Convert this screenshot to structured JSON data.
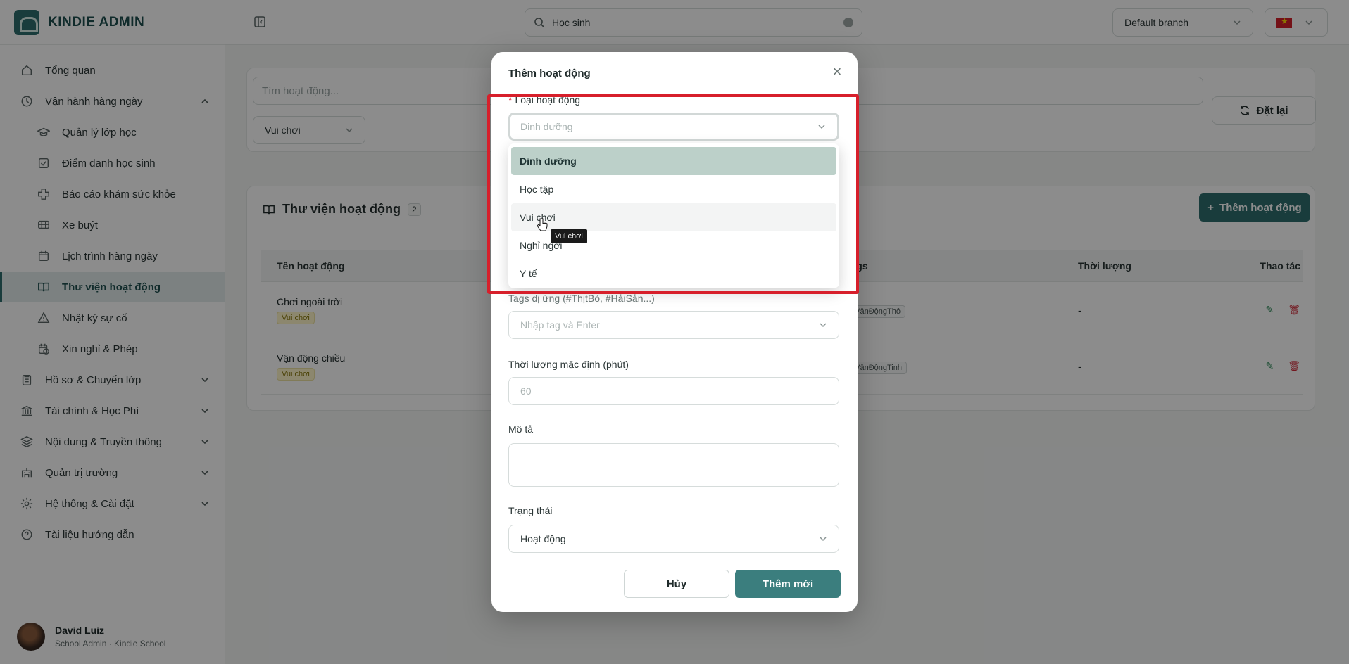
{
  "app": {
    "brand": "KINDIE ADMIN"
  },
  "topbar": {
    "search_value": "Học sinh",
    "branch": "Default branch"
  },
  "sidebar": {
    "items": [
      {
        "label": "Tổng quan"
      },
      {
        "label": "Vận hành hàng ngày"
      },
      {
        "label": "Quản lý lớp học"
      },
      {
        "label": "Điểm danh học sinh"
      },
      {
        "label": "Báo cáo khám sức khỏe"
      },
      {
        "label": "Xe buýt"
      },
      {
        "label": "Lịch trình hàng ngày"
      },
      {
        "label": "Thư viện hoạt động"
      },
      {
        "label": "Nhật ký sự cố"
      },
      {
        "label": "Xin nghỉ & Phép"
      },
      {
        "label": "Hồ sơ & Chuyển lớp"
      },
      {
        "label": "Tài chính & Học Phí"
      },
      {
        "label": "Nội dung & Truyền thông"
      },
      {
        "label": "Quản trị trường"
      },
      {
        "label": "Hệ thống & Cài đặt"
      },
      {
        "label": "Tài liệu hướng dẫn"
      }
    ],
    "user": {
      "name": "David Luiz",
      "role": "School Admin · Kindie School"
    }
  },
  "filters": {
    "search_placeholder": "Tìm hoạt động...",
    "category": "Vui chơi",
    "reset_label": "Đặt lại"
  },
  "library": {
    "title": "Thư viện hoạt động",
    "count": "2",
    "add_label": "Thêm hoạt động",
    "columns": [
      "Tên hoạt động",
      "Tags",
      "Thời lượng",
      "Thao tác"
    ],
    "rows": [
      {
        "name": "Chơi ngoài trời",
        "category": "Vui chơi",
        "tag": "#VậnĐộngThô",
        "duration": "-"
      },
      {
        "name": "Vận động chiều",
        "category": "Vui chơi",
        "tag": "#VậnĐộngTinh",
        "duration": "-"
      }
    ]
  },
  "modal": {
    "title": "Thêm hoạt động",
    "type_label": "Loại hoạt động",
    "type_placeholder": "Dinh dưỡng",
    "options": [
      "Dinh dưỡng",
      "Học tập",
      "Vui chơi",
      "Nghỉ ngơi",
      "Y tế"
    ],
    "tooltip": "Vui chơi",
    "allergy_label": "Tags dị ứng (#ThịtBò, #HảiSản...)",
    "allergy_placeholder": "Nhập tag và Enter",
    "duration_label": "Thời lượng mặc định (phút)",
    "duration_placeholder": "60",
    "desc_label": "Mô tả",
    "status_label": "Trạng thái",
    "status_value": "Hoạt động",
    "cancel_label": "Hủy",
    "submit_label": "Thêm mới"
  },
  "colors": {
    "accent": "#2e6e6e",
    "highlight": "#d71f2b"
  }
}
